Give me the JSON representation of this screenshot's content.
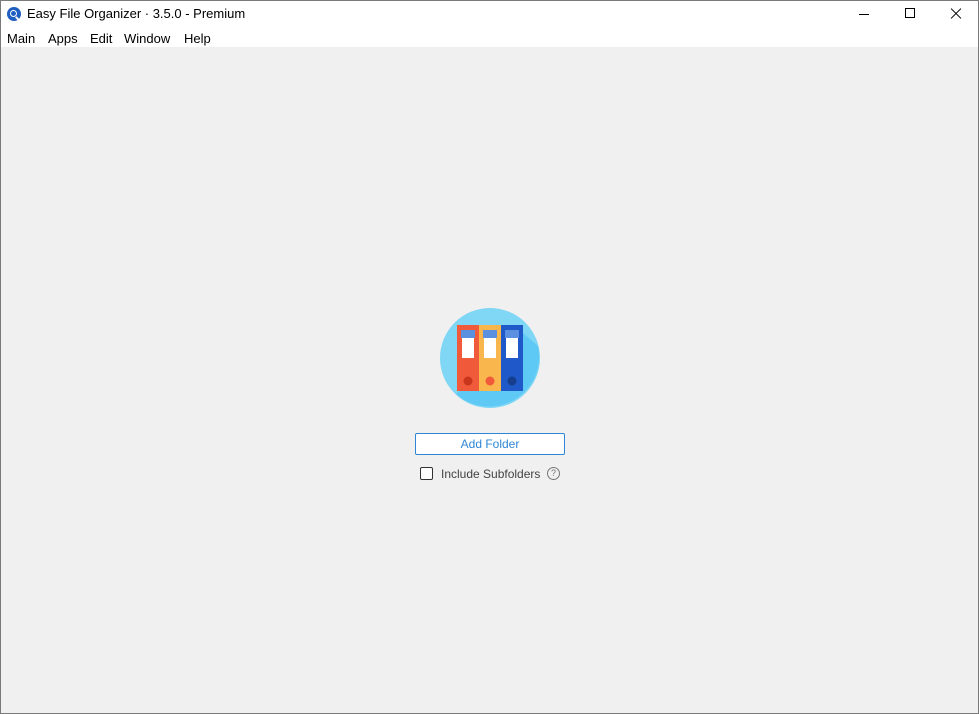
{
  "window": {
    "title": "Easy File Organizer · 3.5.0 - Premium"
  },
  "menu": {
    "items": [
      "Main",
      "Apps",
      "Edit",
      "Window",
      "Help"
    ]
  },
  "main": {
    "add_folder_label": "Add Folder",
    "include_subfolders_label": "Include Subfolders",
    "include_subfolders_checked": false,
    "help_glyph": "?"
  },
  "icons": {
    "app": "magnifier-icon",
    "hero": "binders-icon",
    "help": "question-circle-icon"
  },
  "colors": {
    "accent": "#2f86d6",
    "hero_circle": "#7fd6f5",
    "binder_red": "#f05a3a",
    "binder_yellow": "#f8b64c",
    "binder_blue": "#1f59c9"
  }
}
